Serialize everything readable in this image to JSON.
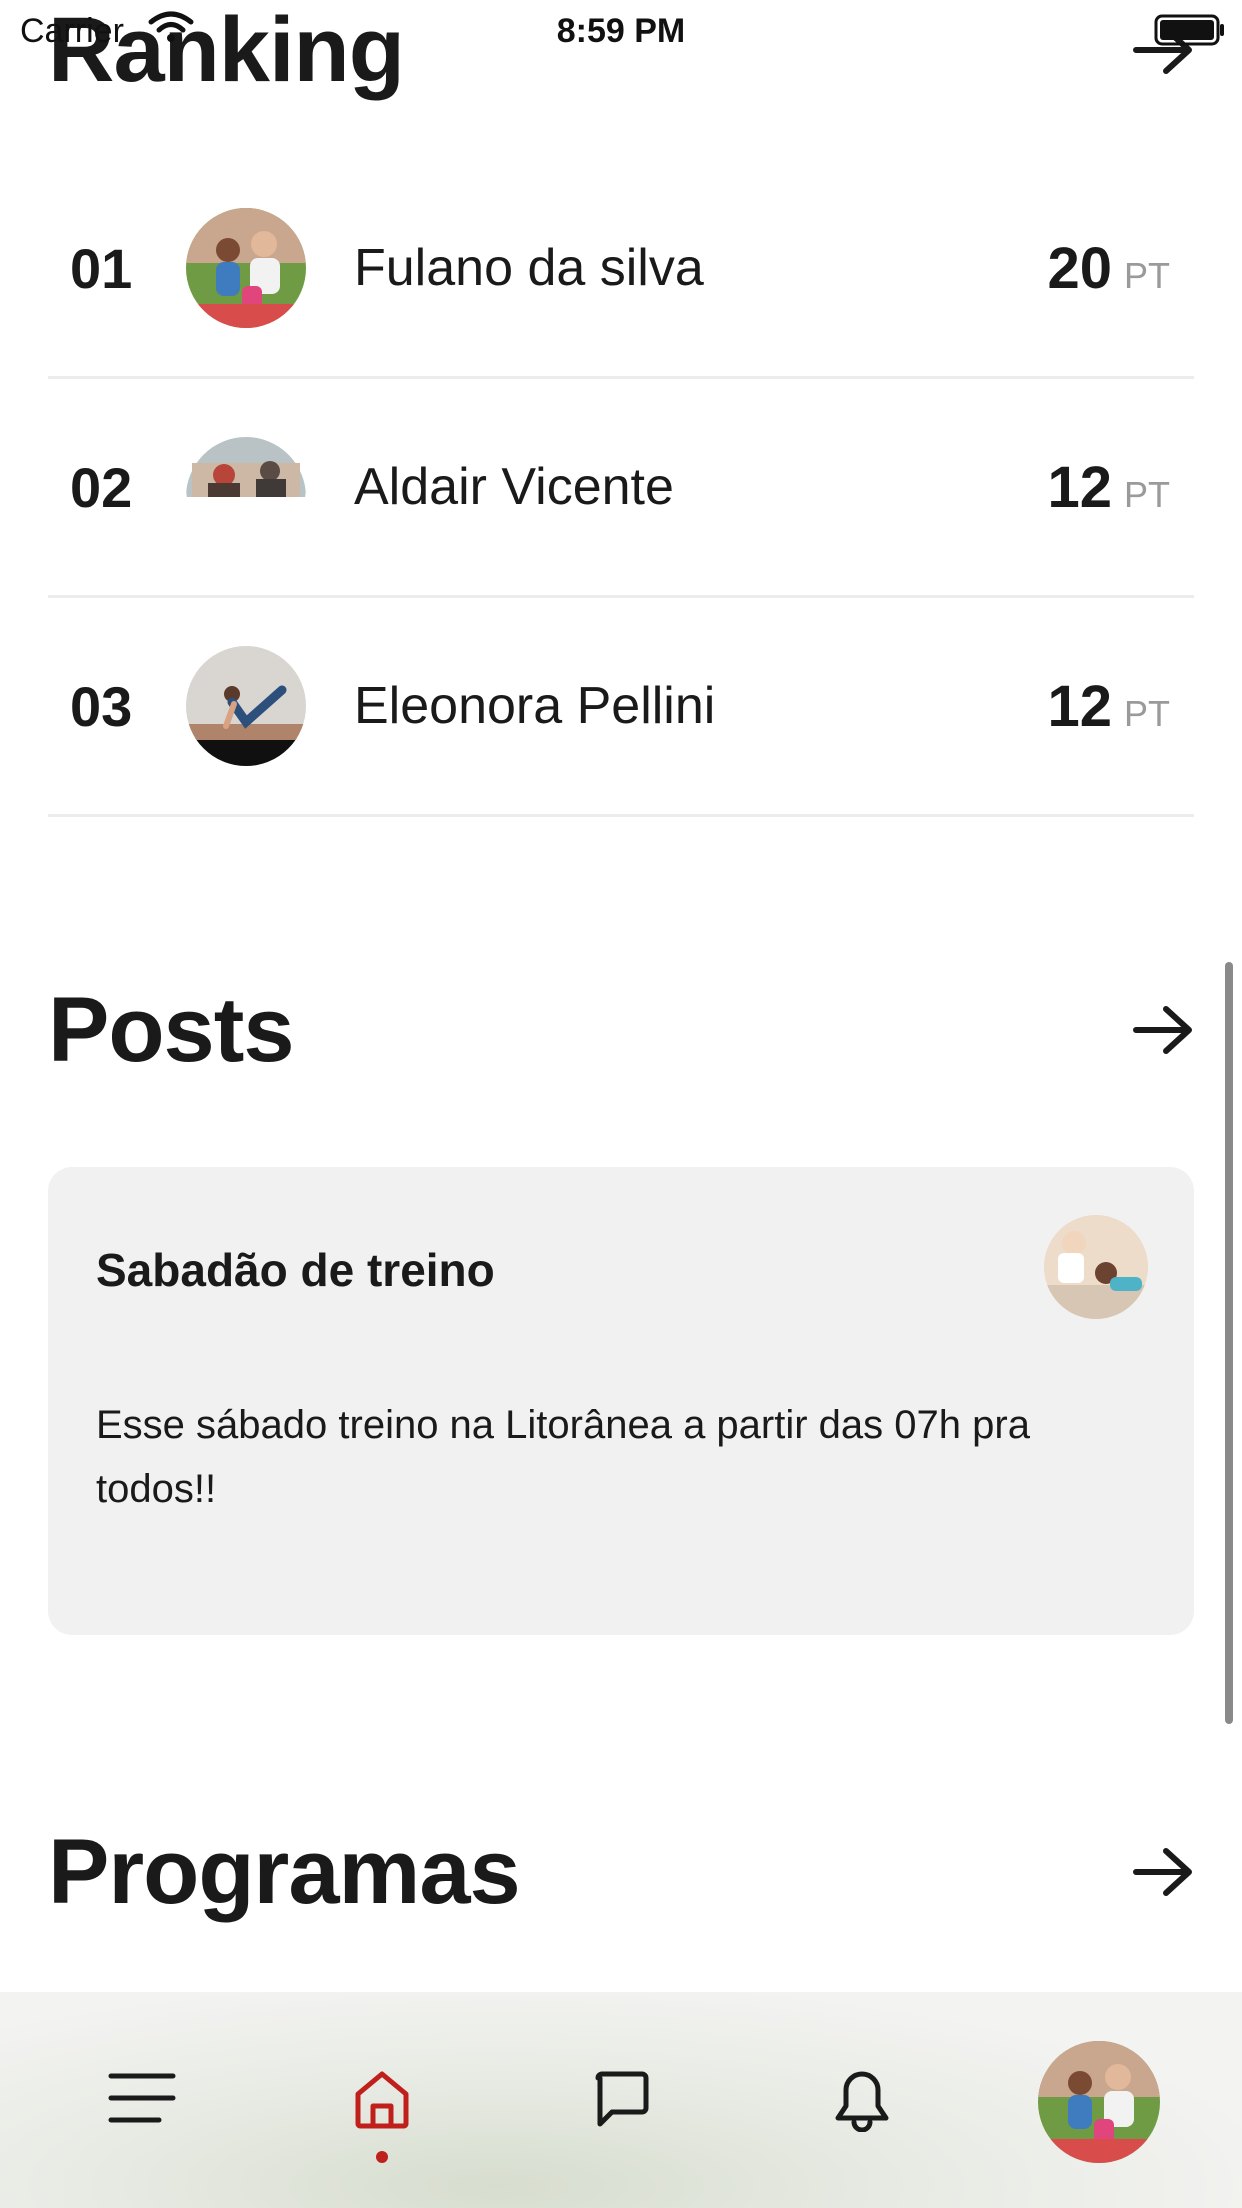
{
  "status_bar": {
    "carrier": "Carrier",
    "time": "8:59 PM"
  },
  "ranking": {
    "title": "Ranking",
    "rows": [
      {
        "position": "01",
        "name": "Fulano da silva",
        "points": "20",
        "unit": "PT"
      },
      {
        "position": "02",
        "name": "Aldair Vicente",
        "points": "12",
        "unit": "PT"
      },
      {
        "position": "03",
        "name": "Eleonora Pellini",
        "points": "12",
        "unit": "PT"
      }
    ]
  },
  "posts": {
    "title": "Posts",
    "card": {
      "title": "Sabadão de treino",
      "body": "Esse sábado treino na Litorânea a partir das 07h pra todos!!"
    }
  },
  "programs": {
    "title": "Programas"
  },
  "tab_bar": {
    "items": [
      {
        "icon": "menu-icon"
      },
      {
        "icon": "home-icon",
        "active": true
      },
      {
        "icon": "chat-icon"
      },
      {
        "icon": "bell-icon"
      },
      {
        "icon": "profile-avatar"
      }
    ],
    "active_color": "#c0201b"
  }
}
